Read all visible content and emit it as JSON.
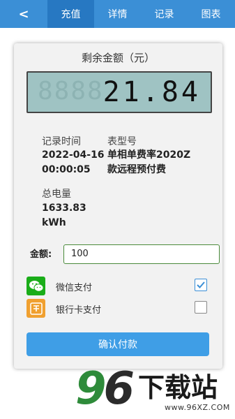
{
  "nav": {
    "back_glyph": "<",
    "tabs": [
      {
        "label": "充值",
        "active": true
      },
      {
        "label": "详情",
        "active": false
      },
      {
        "label": "记录",
        "active": false
      },
      {
        "label": "图表",
        "active": false
      }
    ],
    "accent_color": "#3b8fd6"
  },
  "balance": {
    "title": "剩余金额（元）",
    "lcd_ghost": "8888",
    "amount": "21.84"
  },
  "info": {
    "record_time_label": "记录时间",
    "record_date": "2022-04-16",
    "record_time": "00:00:05",
    "meter_type_label": "表型号",
    "meter_type_line1": "单相单费率2020Z",
    "meter_type_line2": "款远程预付费",
    "total_power_label": "总电量",
    "total_power_value": "1633.83",
    "total_power_unit": "kWh"
  },
  "payment": {
    "amount_label": "金额:",
    "amount_value": "100",
    "methods": [
      {
        "label": "微信支付",
        "icon": "wechat-icon",
        "checked": true,
        "color": "#1aad19"
      },
      {
        "label": "银行卡支付",
        "icon": "bank-card-icon",
        "checked": false,
        "color": "#f0a030"
      }
    ],
    "confirm_label": "确认付款"
  },
  "watermark": {
    "digits_a": "9",
    "digits_b": "6",
    "text": "下载站",
    "url": "www.96XZ.COM"
  }
}
